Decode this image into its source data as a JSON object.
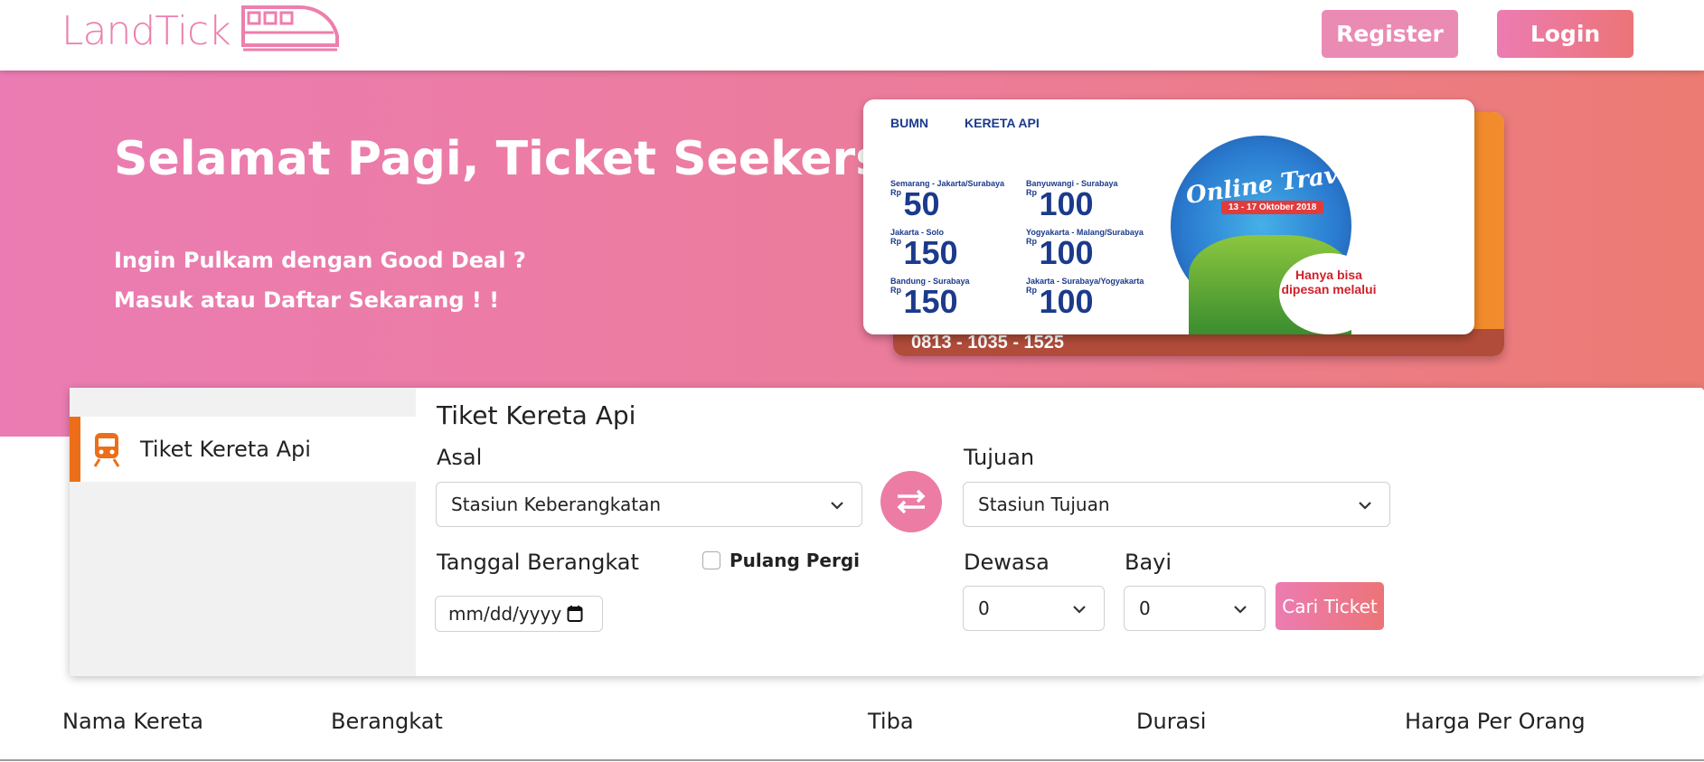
{
  "brand": {
    "name": "LandTick",
    "accent": "#ec7fae"
  },
  "nav": {
    "register_label": "Register",
    "login_label": "Login"
  },
  "hero": {
    "title": "Selamat Pagi, Ticket Seekers !",
    "line1": "Ingin Pulkam dengan Good Deal ?",
    "line2": "Masuk atau Daftar Sekarang ! !"
  },
  "promo": {
    "logo1": "BUMN",
    "logo2": "KERETA API",
    "fair_title": "Online Travel Fair",
    "fair_date": "13 - 17 Oktober 2018",
    "routes": [
      {
        "name": "Semarang - Jakarta/Surabaya",
        "price": "50"
      },
      {
        "name": "Banyuwangi - Surabaya",
        "price": "100"
      },
      {
        "name": "Jakarta - Solo",
        "price": "150"
      },
      {
        "name": "Yogyakarta - Malang/Surabaya",
        "price": "100"
      },
      {
        "name": "Bandung - Surabaya",
        "price": "150"
      },
      {
        "name": "Jakarta - Surabaya/Yogyakarta",
        "price": "100"
      }
    ],
    "rp": "Rp",
    "hanya": "Hanya bisa dipesan melalui",
    "phone": "0813 - 1035 - 1525"
  },
  "search": {
    "tab_label": "Tiket Kereta Api",
    "form_title": "Tiket Kereta Api",
    "asal_label": "Asal",
    "asal_value": "Stasiun Keberangkatan",
    "tujuan_label": "Tujuan",
    "tujuan_value": "Stasiun Tujuan",
    "tanggal_label": "Tanggal Berangkat",
    "pulang_pergi_label": "Pulang Pergi",
    "date_value": "mm/dd/yyyy",
    "dewasa_label": "Dewasa",
    "dewasa_value": "0",
    "bayi_label": "Bayi",
    "bayi_value": "0",
    "cari_label": "Cari Ticket"
  },
  "table": {
    "columns": [
      "Nama Kereta",
      "Berangkat",
      "Tiba",
      "Durasi",
      "Harga Per Orang"
    ]
  }
}
